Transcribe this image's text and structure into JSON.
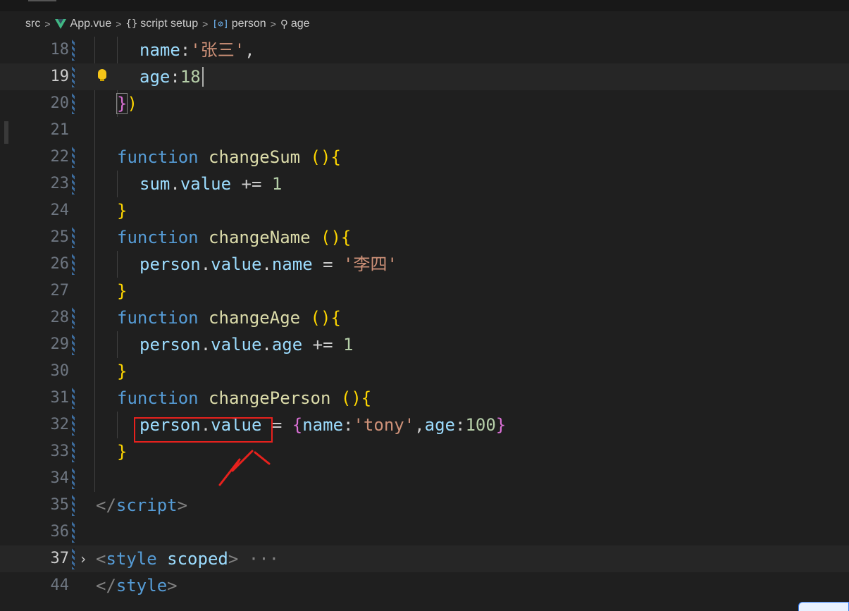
{
  "breadcrumb": {
    "src": "src",
    "file": "App.vue",
    "section": "script setup",
    "variable": "person",
    "property": "age"
  },
  "lines": {
    "l18": {
      "no": "18",
      "name_key": "name",
      "colon": ":",
      "str_val": "'张三'",
      "comma": ","
    },
    "l19": {
      "no": "19",
      "key": "age",
      "colon": ":",
      "num": "18"
    },
    "l20": {
      "no": "20",
      "close_brace": "}",
      "close_paren": ")"
    },
    "l21": {
      "no": "21"
    },
    "l22": {
      "no": "22",
      "kw": "function",
      "fn": "changeSum",
      "open": " ()",
      "brace": "{"
    },
    "l23": {
      "no": "23",
      "obj": "sum",
      "dot": ".",
      "prop": "value",
      "op": " += ",
      "num": "1"
    },
    "l24": {
      "no": "24",
      "brace": "}"
    },
    "l25": {
      "no": "25",
      "kw": "function",
      "fn": "changeName",
      "open": " ()",
      "brace": "{"
    },
    "l26": {
      "no": "26",
      "obj": "person",
      "dot1": ".",
      "prop1": "value",
      "dot2": ".",
      "prop2": "name",
      "op": " = ",
      "str": "'李四'"
    },
    "l27": {
      "no": "27",
      "brace": "}"
    },
    "l28": {
      "no": "28",
      "kw": "function",
      "fn": "changeAge",
      "open": " ()",
      "brace": "{"
    },
    "l29": {
      "no": "29",
      "obj": "person",
      "dot1": ".",
      "prop1": "value",
      "dot2": ".",
      "prop2": "age",
      "op": " += ",
      "num": "1"
    },
    "l30": {
      "no": "30",
      "brace": "}"
    },
    "l31": {
      "no": "31",
      "kw": "function",
      "fn": "changePerson",
      "open": " ()",
      "brace": "{"
    },
    "l32": {
      "no": "32",
      "obj": "person",
      "dot": ".",
      "prop": "value",
      "op": " = ",
      "open": "{",
      "k1": "name",
      "c1": ":",
      "s1": "'tony'",
      "comma": ",",
      "k2": "age",
      "c2": ":",
      "n2": "100",
      "close": "}"
    },
    "l33": {
      "no": "33",
      "brace": "}"
    },
    "l34": {
      "no": "34"
    },
    "l35": {
      "no": "35",
      "open": "</",
      "tag": "script",
      "close": ">"
    },
    "l36": {
      "no": "36"
    },
    "l37": {
      "no": "37",
      "open": "<",
      "tag": "style",
      "attr": " scoped",
      "close": ">",
      "fold": "···"
    },
    "l44": {
      "no": "44",
      "open": "</",
      "tag": "style",
      "close": ">"
    }
  },
  "colors": {
    "annotation": "#e8211d",
    "keyword": "#569cd6",
    "function": "#dcdcaa",
    "variable": "#9cdcfe",
    "number": "#b5cea8",
    "string": "#ce9178"
  },
  "icons": {
    "breadcrumb_sep": "chevron-right-icon",
    "vue": "vue-logo-icon",
    "variable": "symbol-variable-icon",
    "property": "wrench-icon",
    "lightbulb": "lightbulb-icon",
    "fold": "chevron-right-icon"
  }
}
